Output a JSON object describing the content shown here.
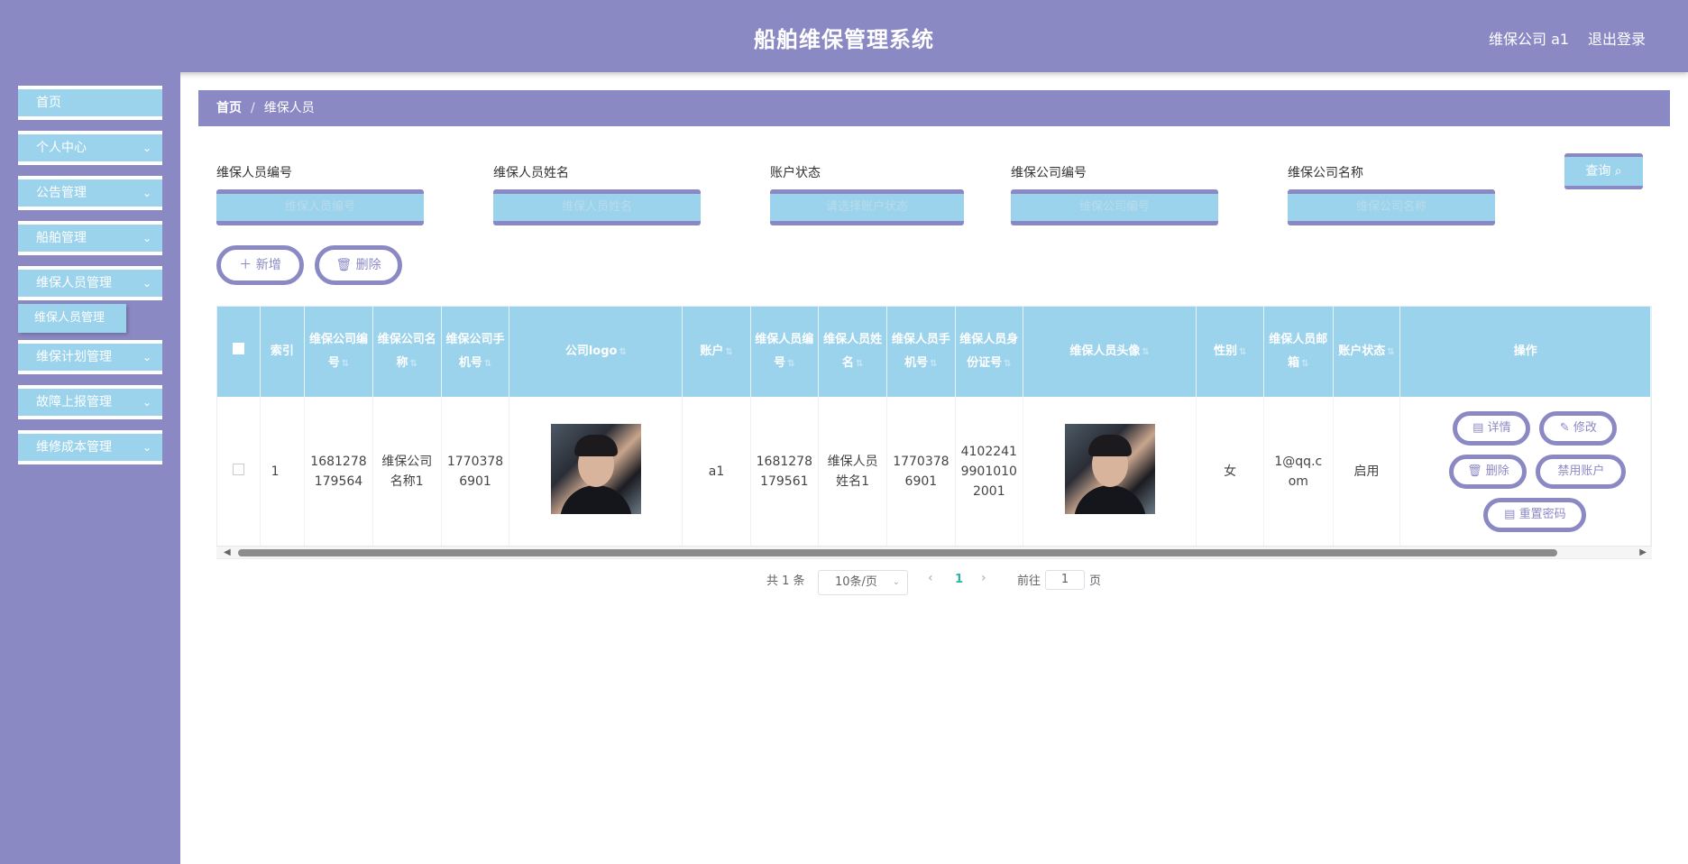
{
  "header": {
    "title": "船舶维保管理系统",
    "user": "维保公司 a1",
    "logout": "退出登录"
  },
  "sidebar": {
    "items": [
      {
        "label": "首页"
      },
      {
        "label": "个人中心"
      },
      {
        "label": "公告管理"
      },
      {
        "label": "船舶管理"
      },
      {
        "label": "维保人员管理"
      },
      {
        "label": "维保计划管理"
      },
      {
        "label": "故障上报管理"
      },
      {
        "label": "维修成本管理"
      }
    ],
    "sub_active": "维保人员管理",
    "chevron": "⌄"
  },
  "breadcrumb": {
    "home": "首页",
    "separator": "/",
    "current": "维保人员"
  },
  "search": {
    "fields": [
      {
        "label": "维保人员编号",
        "placeholder": "维保人员编号"
      },
      {
        "label": "维保人员姓名",
        "placeholder": "维保人员姓名"
      },
      {
        "label": "账户状态",
        "placeholder": "请选择账户状态"
      },
      {
        "label": "维保公司编号",
        "placeholder": "维保公司编号"
      },
      {
        "label": "维保公司名称",
        "placeholder": "维保公司名称"
      }
    ],
    "query_label": "查询"
  },
  "actions": {
    "add": "新增",
    "delete": "删除"
  },
  "table": {
    "headers": [
      {
        "key": "index",
        "label": "索引",
        "sortable": false
      },
      {
        "key": "company_no",
        "label": "维保公司编号",
        "sortable": true
      },
      {
        "key": "company_name",
        "label": "维保公司名称",
        "sortable": true
      },
      {
        "key": "company_phone",
        "label": "维保公司手机号",
        "sortable": true
      },
      {
        "key": "company_logo",
        "label": "公司logo",
        "sortable": true
      },
      {
        "key": "account",
        "label": "账户",
        "sortable": true
      },
      {
        "key": "staff_no",
        "label": "维保人员编号",
        "sortable": true
      },
      {
        "key": "staff_name",
        "label": "维保人员姓名",
        "sortable": true
      },
      {
        "key": "staff_phone",
        "label": "维保人员手机号",
        "sortable": true
      },
      {
        "key": "staff_id",
        "label": "维保人员身份证号",
        "sortable": true
      },
      {
        "key": "staff_avatar",
        "label": "维保人员头像",
        "sortable": true
      },
      {
        "key": "gender",
        "label": "性别",
        "sortable": true
      },
      {
        "key": "email",
        "label": "维保人员邮箱",
        "sortable": true
      },
      {
        "key": "status",
        "label": "账户状态",
        "sortable": true
      },
      {
        "key": "ops",
        "label": "操作",
        "sortable": false
      }
    ],
    "rows": [
      {
        "index": "1",
        "company_no": "1681278179564",
        "company_name": "维保公司名称1",
        "company_phone": "17703786901",
        "account": "a1",
        "staff_no": "1681278179561",
        "staff_name": "维保人员姓名1",
        "staff_phone": "17703786901",
        "staff_id": "410224199010102001",
        "gender": "女",
        "email": "1@qq.com",
        "status": "启用"
      }
    ],
    "row_ops": {
      "detail": "详情",
      "edit": "修改",
      "delete": "删除",
      "disable": "禁用账户",
      "reset": "重置密码"
    }
  },
  "pagination": {
    "total": "共 1 条",
    "page_size": "10条/页",
    "current_page": "1",
    "goto_label": "前往",
    "goto_value": "1",
    "page_suffix": "页"
  },
  "colors": {
    "primary": "#8b89c4",
    "accent": "#9bd3ec",
    "page_active": "#29b6a4"
  }
}
